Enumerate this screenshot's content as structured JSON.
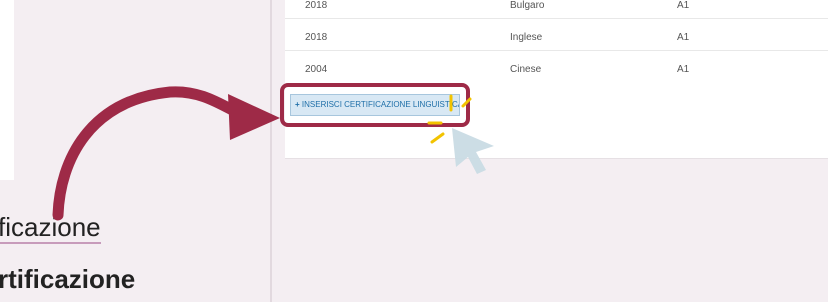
{
  "left_text": {
    "line1": "ficazione",
    "line2": "rtificazione"
  },
  "table": {
    "rows": [
      {
        "year": "2018",
        "language": "Bulgaro",
        "level": "A1"
      },
      {
        "year": "2018",
        "language": "Inglese",
        "level": "A1"
      },
      {
        "year": "2004",
        "language": "Cinese",
        "level": "A1"
      }
    ]
  },
  "add_button": {
    "icon": "plus-icon",
    "label": "INSERISCI CERTIFICAZIONE LINGUISTICA"
  },
  "colors": {
    "highlight": "#9e2a47",
    "arrow": "#9e2a47",
    "button_bg": "#d8e8f4",
    "button_text": "#1f6fa8",
    "sparkle": "#f2c300",
    "cursor": "#c9dbe4"
  }
}
